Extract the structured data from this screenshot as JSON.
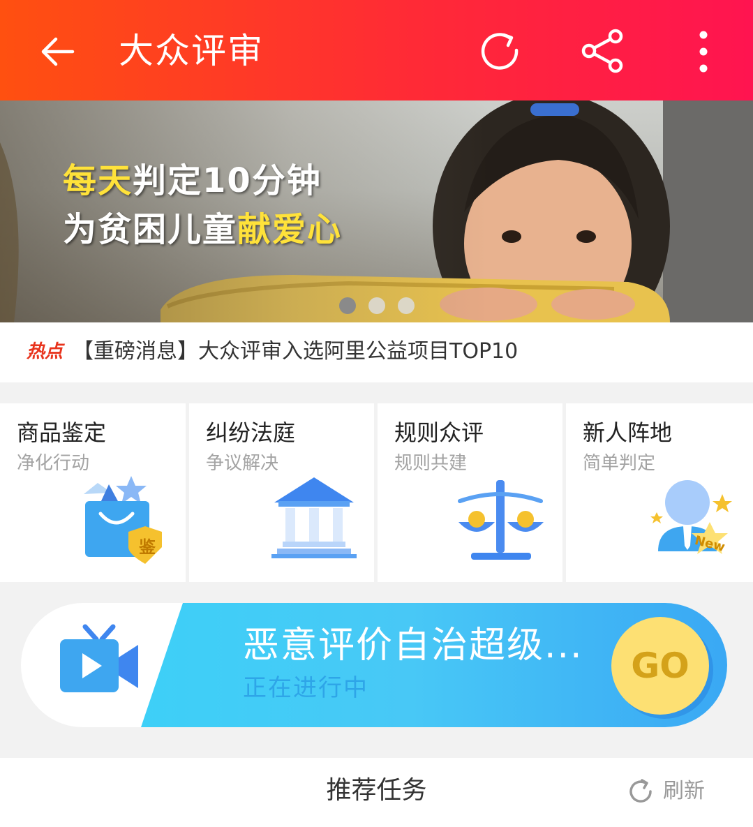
{
  "header": {
    "title": "大众评审",
    "back_icon": "arrow-left-icon",
    "refresh_icon": "refresh-icon",
    "share_icon": "share-icon",
    "more_icon": "more-vertical-icon",
    "gradient": [
      "#ff5010",
      "#ff1450"
    ]
  },
  "banner": {
    "line1_a": "每天",
    "line1_b": "判定10分钟",
    "line2_a": "为贫困儿童",
    "line2_b": "献爱心",
    "slide_count": 3,
    "active_slide": 1
  },
  "hot": {
    "tag": "热点",
    "text": "【重磅消息】大众评审入选阿里公益项目TOP10"
  },
  "cards": [
    {
      "title": "商品鉴定",
      "subtitle": "净化行动",
      "icon": "shopping-bag-icon",
      "badge": "鉴"
    },
    {
      "title": "纠纷法庭",
      "subtitle": "争议解决",
      "icon": "courthouse-icon"
    },
    {
      "title": "规则众评",
      "subtitle": "规则共建",
      "icon": "scale-icon"
    },
    {
      "title": "新人阵地",
      "subtitle": "简单判定",
      "icon": "newbie-user-icon",
      "badge": "New"
    }
  ],
  "promo": {
    "title": "恶意评价自治超级...",
    "status": "正在进行中",
    "button": "GO",
    "icon": "video-tv-icon"
  },
  "bottom": {
    "title": "推荐任务",
    "refresh_label": "刷新",
    "refresh_icon": "refresh-icon"
  }
}
